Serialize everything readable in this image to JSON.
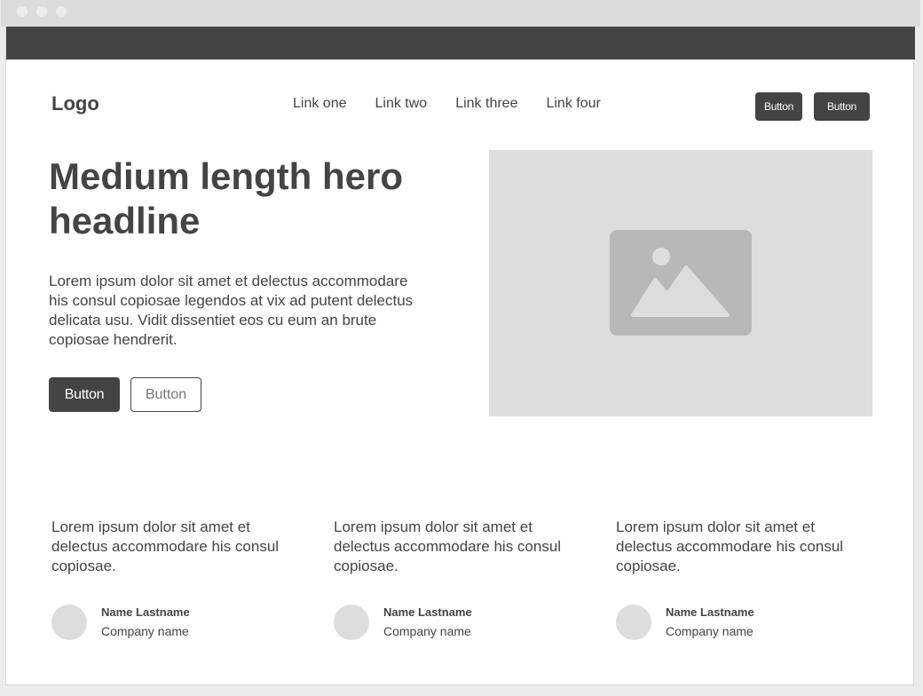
{
  "header": {
    "logo": "Logo",
    "nav_links": [
      "Link one",
      "Link two",
      "Link three",
      "Link four"
    ],
    "buttons": [
      "Button",
      "Button"
    ]
  },
  "hero": {
    "headline": "Medium length hero headline",
    "body": "Lorem ipsum dolor sit amet et delectus accommodare his consul copiosae legendos at vix ad putent delectus delicata usu. Vidit dissentiet eos cu eum an brute copiosae hendrerit.",
    "primary_button": "Button",
    "secondary_button": "Button",
    "image_icon": "image-placeholder-icon"
  },
  "testimonials": [
    {
      "quote": "Lorem ipsum dolor sit amet et delectus accommodare his consul copiosae.",
      "name": "Name Lastname",
      "company": "Company name"
    },
    {
      "quote": "Lorem ipsum dolor sit amet et delectus accommodare his consul copiosae.",
      "name": "Name Lastname",
      "company": "Company name"
    },
    {
      "quote": "Lorem ipsum dolor sit amet et delectus accommodare his consul copiosae.",
      "name": "Name Lastname",
      "company": "Company name"
    }
  ],
  "colors": {
    "dark": "#444444",
    "placeholder": "#dddddd",
    "placeholder_icon": "#b8b8b8"
  }
}
